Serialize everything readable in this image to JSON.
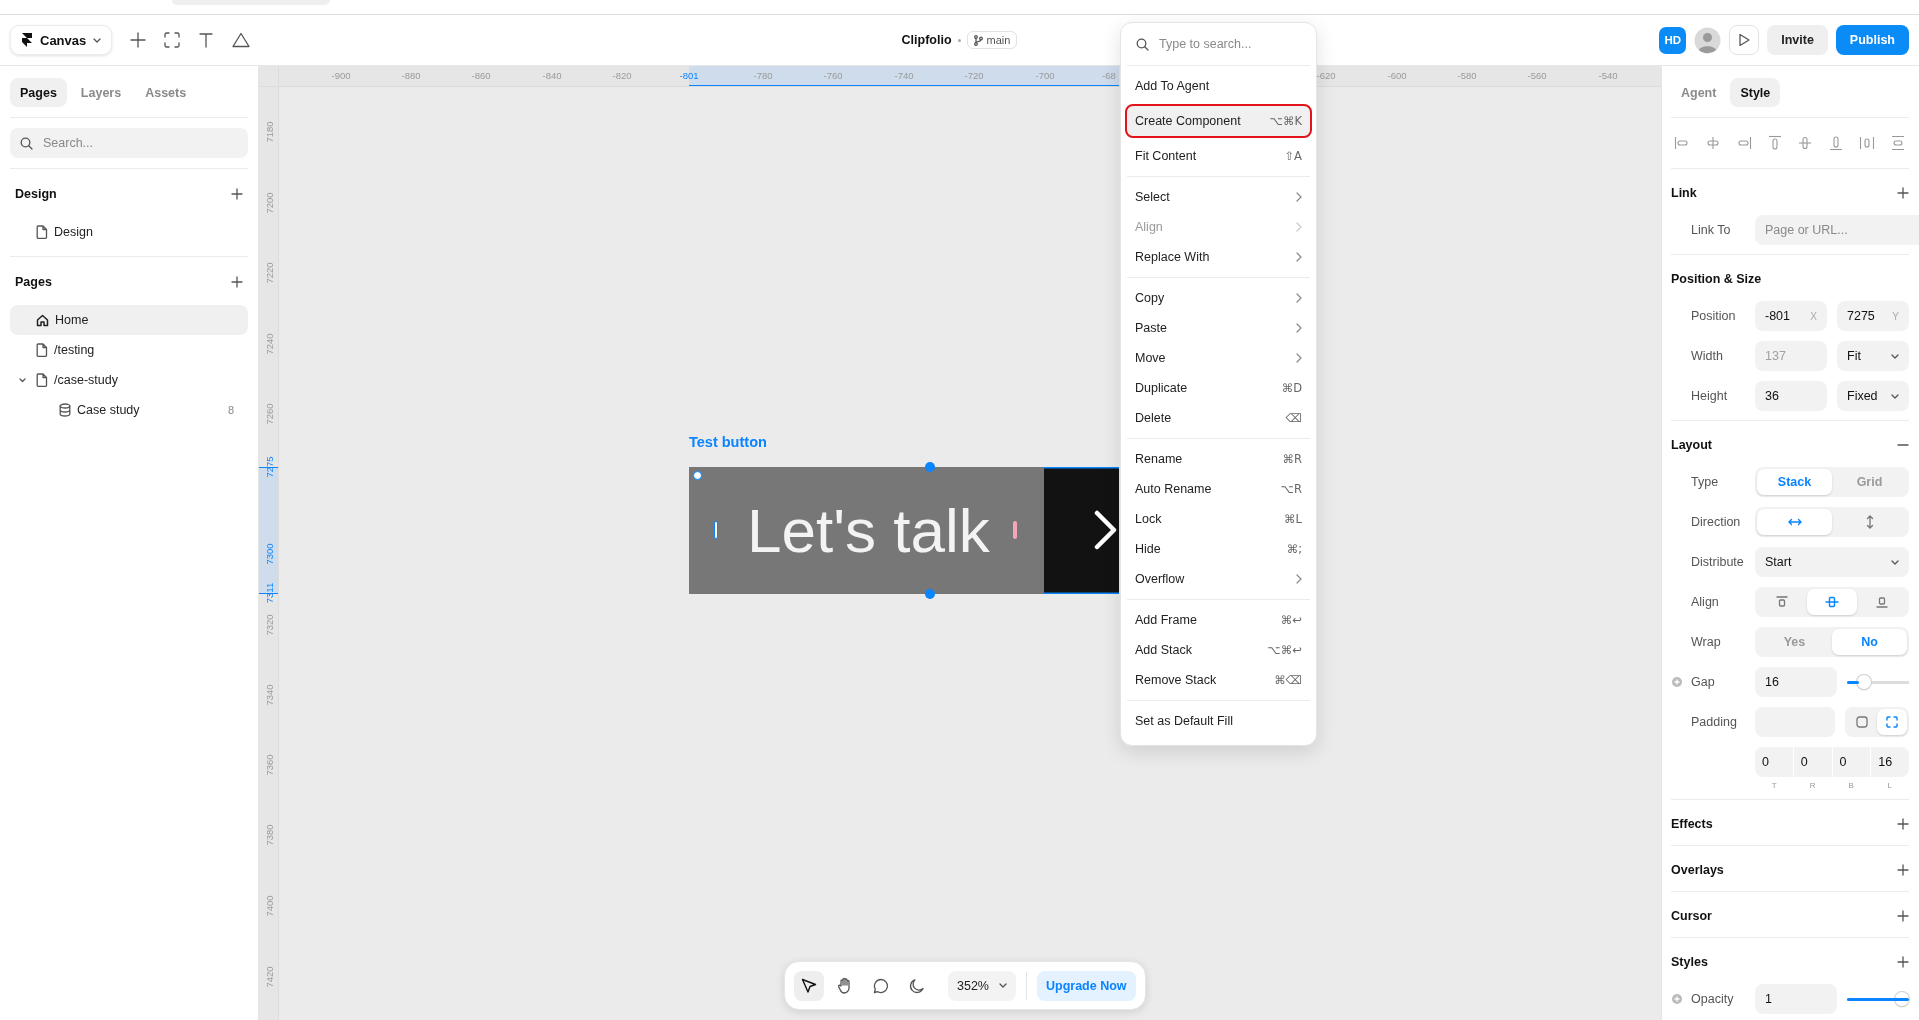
{
  "top_bar": {
    "project": "Canvas",
    "title": "Clipfolio",
    "branch": "main",
    "avatar": "HD",
    "buttons": [
      {
        "label": "Invite",
        "kind": "secondary"
      },
      {
        "label": "Publish",
        "kind": "primary"
      }
    ]
  },
  "sidebar": {
    "tabs": [
      {
        "label": "Pages",
        "selected": true
      },
      {
        "label": "Layers",
        "selected": false
      },
      {
        "label": "Assets",
        "selected": false
      }
    ],
    "search": {
      "placeholder": "Search..."
    },
    "sections": [
      {
        "title": "Design",
        "items": [
          {
            "label": "Design",
            "kind": "page",
            "selected": false
          }
        ]
      },
      {
        "title": "Pages",
        "items": [
          {
            "label": "Home",
            "kind": "home",
            "selected": true
          },
          {
            "label": "/testing",
            "kind": "page",
            "selected": false
          },
          {
            "label": "/case-study",
            "kind": "page",
            "selected": false,
            "expanded": true,
            "children": [
              {
                "label": "Case study",
                "kind": "collection",
                "count": "8",
                "selected": false
              }
            ]
          }
        ]
      }
    ]
  },
  "canvas": {
    "ruler_x": [
      {
        "label": "-900",
        "selected": false
      },
      {
        "label": "-880",
        "selected": false
      },
      {
        "label": "-860",
        "selected": false
      },
      {
        "label": "-840",
        "selected": false
      },
      {
        "label": "-820",
        "selected": false
      },
      {
        "label": "-801",
        "selected": true
      },
      {
        "label": "-780",
        "selected": false
      },
      {
        "label": "-760",
        "selected": false
      },
      {
        "label": "-740",
        "selected": false
      },
      {
        "label": "-720",
        "selected": false
      },
      {
        "label": "-700",
        "selected": false
      },
      {
        "label": "-68",
        "selected": false
      },
      {
        "label": "-620",
        "selected": false
      },
      {
        "label": "-600",
        "selected": false
      },
      {
        "label": "-580",
        "selected": false
      },
      {
        "label": "-560",
        "selected": false
      },
      {
        "label": "-540",
        "selected": false
      }
    ],
    "ruler_y": [
      {
        "label": "7180",
        "selected": false
      },
      {
        "label": "7200",
        "selected": false
      },
      {
        "label": "7220",
        "selected": false
      },
      {
        "label": "7240",
        "selected": false
      },
      {
        "label": "7260",
        "selected": false
      },
      {
        "label": "7275",
        "selected": true
      },
      {
        "label": "7300",
        "selected": true
      },
      {
        "label": "7311",
        "selected": true
      },
      {
        "label": "7320",
        "selected": false
      },
      {
        "label": "7340",
        "selected": false
      },
      {
        "label": "7360",
        "selected": false
      },
      {
        "label": "7380",
        "selected": false
      },
      {
        "label": "7400",
        "selected": false
      },
      {
        "label": "7420",
        "selected": false
      }
    ],
    "frame": {
      "name": "Test button",
      "text": "Let's talk",
      "selected": true
    }
  },
  "toolbar": {
    "tools": [
      {
        "kind": "pointer",
        "selected": true
      },
      {
        "kind": "hand",
        "selected": false
      },
      {
        "kind": "comment",
        "selected": false
      },
      {
        "kind": "theme",
        "selected": false
      }
    ],
    "zoom": "352%",
    "upgrade": "Upgrade Now"
  },
  "context_menu": {
    "search": {
      "placeholder": "Type to search..."
    },
    "groups": [
      [
        {
          "label": "Add To Agent",
          "kind": "plain",
          "disabled": false,
          "highlighted": false
        },
        {
          "label": "Create Component",
          "kind": "shortcut",
          "shortcut": "⌥⌘K",
          "disabled": false,
          "highlighted": true
        },
        {
          "label": "Fit Content",
          "kind": "shortcut",
          "shortcut": "⇧A",
          "disabled": false,
          "highlighted": false
        }
      ],
      [
        {
          "label": "Select",
          "kind": "submenu",
          "disabled": false,
          "highlighted": false
        },
        {
          "label": "Align",
          "kind": "submenu",
          "disabled": true,
          "highlighted": false
        },
        {
          "label": "Replace With",
          "kind": "submenu",
          "disabled": false,
          "highlighted": false
        }
      ],
      [
        {
          "label": "Copy",
          "kind": "submenu",
          "disabled": false,
          "highlighted": false
        },
        {
          "label": "Paste",
          "kind": "submenu",
          "disabled": false,
          "highlighted": false
        },
        {
          "label": "Move",
          "kind": "submenu",
          "disabled": false,
          "highlighted": false
        },
        {
          "label": "Duplicate",
          "kind": "shortcut",
          "shortcut": "⌘D",
          "disabled": false,
          "highlighted": false
        },
        {
          "label": "Delete",
          "kind": "shortcut",
          "shortcut": "⌫",
          "disabled": false,
          "highlighted": false
        }
      ],
      [
        {
          "label": "Rename",
          "kind": "shortcut",
          "shortcut": "⌘R",
          "disabled": false,
          "highlighted": false
        },
        {
          "label": "Auto Rename",
          "kind": "shortcut",
          "shortcut": "⌥R",
          "disabled": false,
          "highlighted": false
        },
        {
          "label": "Lock",
          "kind": "shortcut",
          "shortcut": "⌘L",
          "disabled": false,
          "highlighted": false
        },
        {
          "label": "Hide",
          "kind": "shortcut",
          "shortcut": "⌘;",
          "disabled": false,
          "highlighted": false
        },
        {
          "label": "Overflow",
          "kind": "submenu",
          "disabled": false,
          "highlighted": false
        }
      ],
      [
        {
          "label": "Add Frame",
          "kind": "shortcut",
          "shortcut": "⌘↩",
          "disabled": false,
          "highlighted": false
        },
        {
          "label": "Add Stack",
          "kind": "shortcut",
          "shortcut": "⌥⌘↩",
          "disabled": false,
          "highlighted": false
        },
        {
          "label": "Remove Stack",
          "kind": "shortcut",
          "shortcut": "⌘⌫",
          "disabled": false,
          "highlighted": false
        }
      ],
      [
        {
          "label": "Set as Default Fill",
          "kind": "plain",
          "disabled": false,
          "highlighted": false
        }
      ]
    ]
  },
  "inspector": {
    "tabs": [
      {
        "label": "Agent",
        "selected": false
      },
      {
        "label": "Style",
        "selected": true
      }
    ],
    "sections": [
      {
        "title": "Link",
        "kind": "add",
        "rows": [
          {
            "label": "Link To",
            "kind": "field",
            "placeholder": "Page or URL..."
          }
        ]
      },
      {
        "title": "Position & Size",
        "kind": "plain",
        "rows": [
          {
            "label": "Position",
            "kind": "pair",
            "fields": [
              {
                "value": "-801",
                "unit": "X"
              },
              {
                "value": "7275",
                "unit": "Y"
              }
            ]
          },
          {
            "label": "Width",
            "kind": "size",
            "value": "137",
            "disabled": true,
            "mode": "Fit"
          },
          {
            "label": "Height",
            "kind": "size",
            "value": "36",
            "disabled": false,
            "mode": "Fixed"
          }
        ]
      },
      {
        "title": "Layout",
        "kind": "remove",
        "rows": [
          {
            "label": "Type",
            "kind": "segmented",
            "options": [
              {
                "label": "Stack",
                "selected": true
              },
              {
                "label": "Grid",
                "selected": false
              }
            ]
          },
          {
            "label": "Direction",
            "kind": "direction",
            "options": [
              {
                "selected": true
              },
              {
                "selected": false
              }
            ]
          },
          {
            "label": "Distribute",
            "kind": "select",
            "value": "Start"
          },
          {
            "label": "Align",
            "kind": "align",
            "options": [
              {
                "selected": false
              },
              {
                "selected": true
              },
              {
                "selected": false
              }
            ]
          },
          {
            "label": "Wrap",
            "kind": "segmented",
            "options": [
              {
                "label": "Yes",
                "selected": false
              },
              {
                "label": "No",
                "selected": true
              }
            ]
          },
          {
            "label": "Gap",
            "kind": "slider",
            "value": "16",
            "level": 0.2
          },
          {
            "label": "Padding",
            "kind": "padding",
            "modes": [
              {
                "selected": false
              },
              {
                "selected": true
              }
            ],
            "sides": [
              {
                "value": "0",
                "label": "T"
              },
              {
                "value": "0",
                "label": "R"
              },
              {
                "value": "0",
                "label": "B"
              },
              {
                "value": "16",
                "label": "L"
              }
            ]
          }
        ]
      },
      {
        "title": "Effects",
        "kind": "add"
      },
      {
        "title": "Overlays",
        "kind": "add"
      },
      {
        "title": "Cursor",
        "kind": "add"
      },
      {
        "title": "Styles",
        "kind": "add",
        "rows": [
          {
            "label": "Opacity",
            "kind": "slider",
            "value": "1",
            "level": 1
          }
        ]
      }
    ]
  }
}
